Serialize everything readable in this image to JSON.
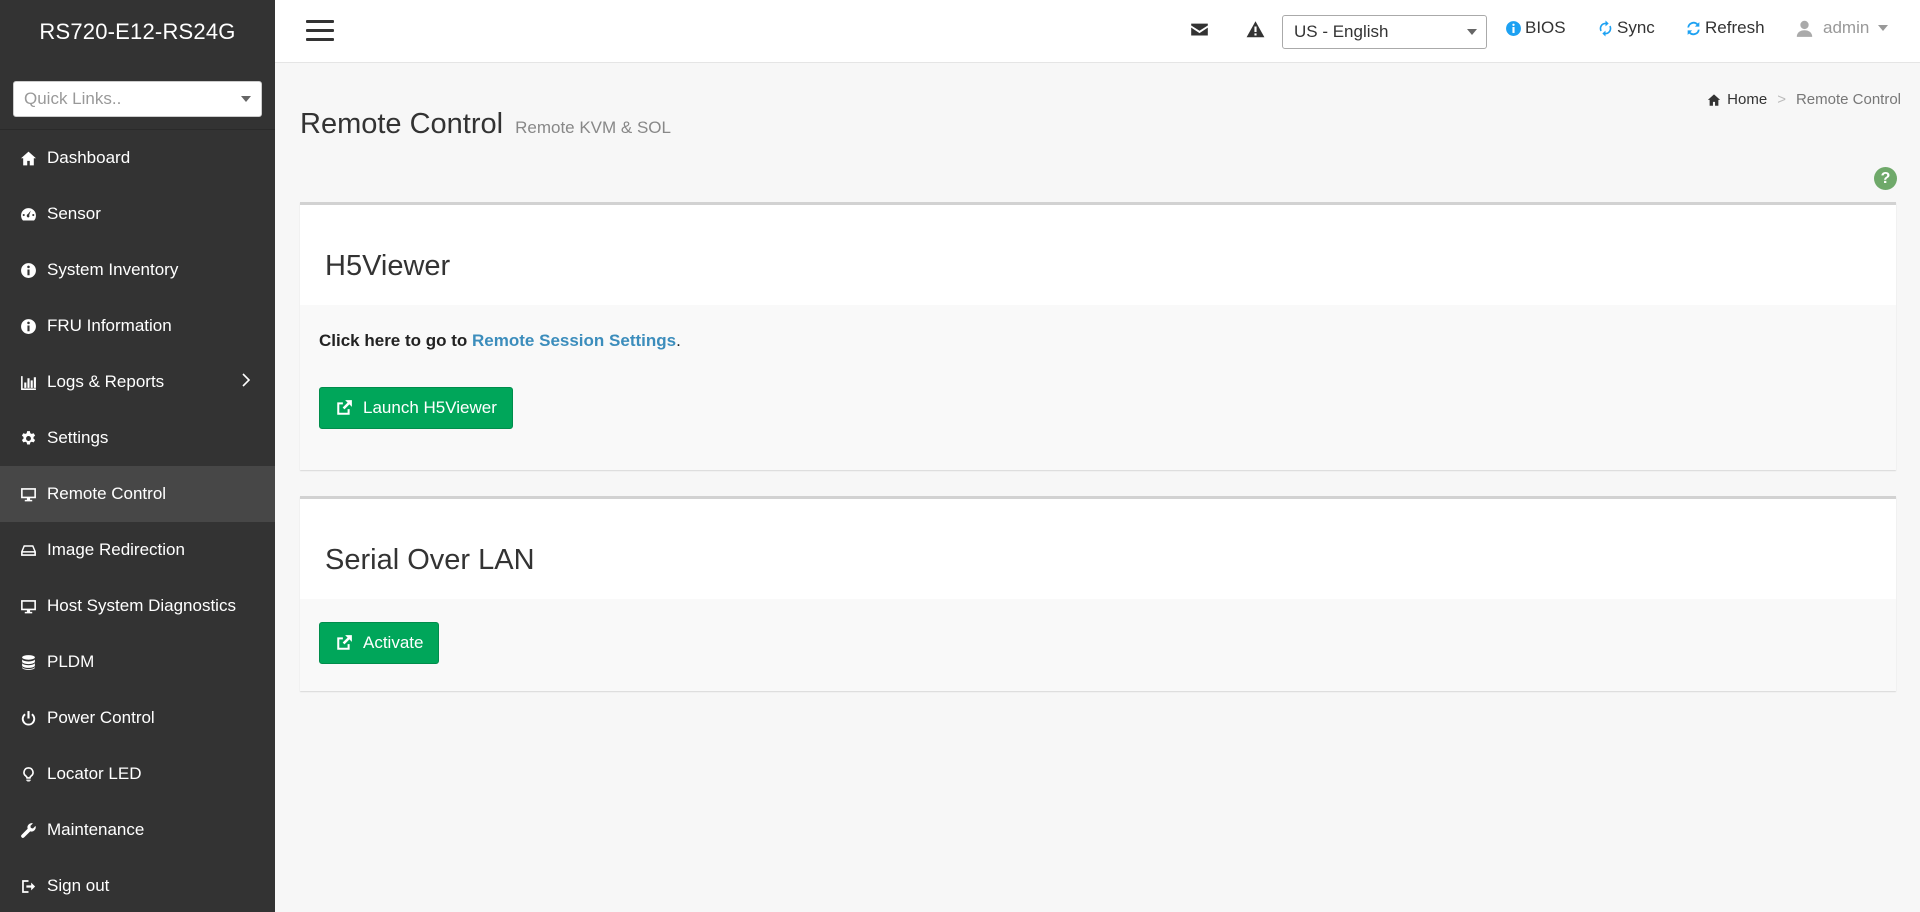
{
  "sidebar": {
    "brand": "RS720-E12-RS24G",
    "quick_links_placeholder": "Quick Links..",
    "items": [
      {
        "label": "Dashboard",
        "icon": "home-icon"
      },
      {
        "label": "Sensor",
        "icon": "dashboard-gauge-icon"
      },
      {
        "label": "System Inventory",
        "icon": "info-circle-icon"
      },
      {
        "label": "FRU Information",
        "icon": "info-circle-icon"
      },
      {
        "label": "Logs & Reports",
        "icon": "bar-chart-icon",
        "has_submenu": true
      },
      {
        "label": "Settings",
        "icon": "gear-icon"
      },
      {
        "label": "Remote Control",
        "icon": "desktop-icon",
        "active": true
      },
      {
        "label": "Image Redirection",
        "icon": "drive-icon"
      },
      {
        "label": "Host System Diagnostics",
        "icon": "desktop-icon"
      },
      {
        "label": "PLDM",
        "icon": "database-icon"
      },
      {
        "label": "Power Control",
        "icon": "power-icon"
      },
      {
        "label": "Locator LED",
        "icon": "lightbulb-icon"
      },
      {
        "label": "Maintenance",
        "icon": "wrench-icon"
      },
      {
        "label": "Sign out",
        "icon": "sign-out-icon"
      }
    ]
  },
  "header": {
    "language": "US - English",
    "bios_label": "BIOS",
    "sync_label": "Sync",
    "refresh_label": "Refresh",
    "user_label": "admin",
    "icons": [
      "envelope-icon",
      "warning-icon"
    ]
  },
  "page": {
    "title": "Remote Control",
    "subtitle": "Remote KVM & SOL",
    "breadcrumb": {
      "home": "Home",
      "current": "Remote Control"
    },
    "help": "?"
  },
  "h5viewer": {
    "title": "H5Viewer",
    "note_prefix": "Click here to go to ",
    "note_link": "Remote Session Settings",
    "note_suffix": ".",
    "launch_button": "Launch H5Viewer"
  },
  "sol": {
    "title": "Serial Over LAN",
    "activate_button": "Activate"
  },
  "colors": {
    "sidebar_bg": "#333333",
    "active_item_bg": "#474747",
    "button_green": "#00a65a",
    "link_blue": "#3c8dbc",
    "info_blue": "#1da1f2"
  }
}
